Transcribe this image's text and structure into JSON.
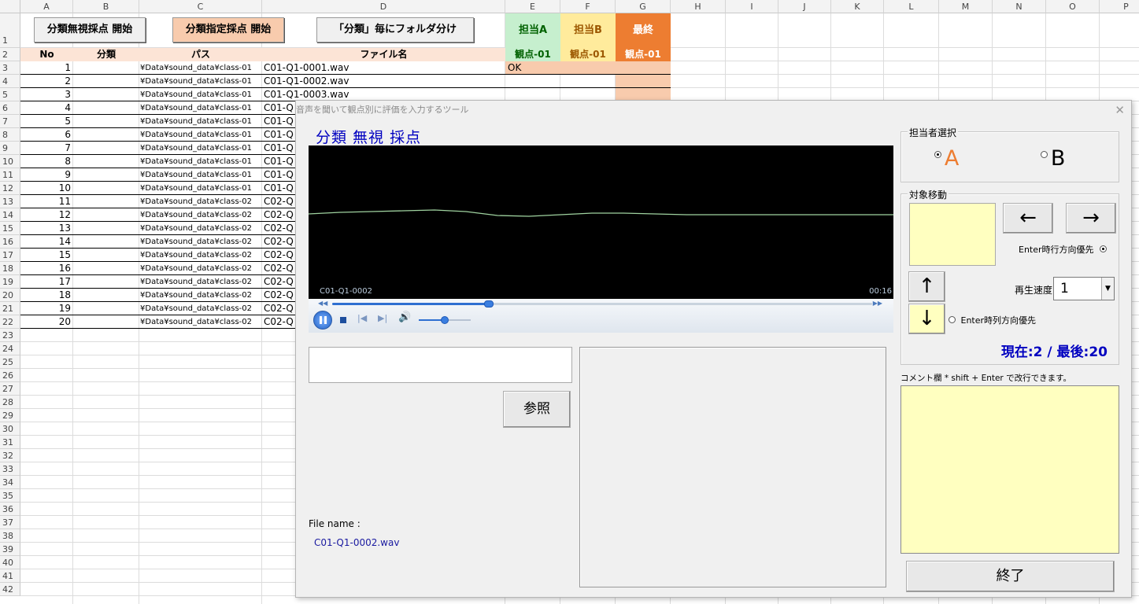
{
  "sheet": {
    "columns": [
      "A",
      "B",
      "C",
      "D",
      "E",
      "F",
      "G",
      "H",
      "I",
      "J",
      "K",
      "L",
      "M",
      "N",
      "O",
      "P"
    ],
    "rows": [
      "1",
      "2",
      "3",
      "4",
      "5",
      "6",
      "7",
      "8",
      "9",
      "10",
      "11",
      "12",
      "13",
      "14",
      "15",
      "16",
      "17",
      "18",
      "19",
      "20",
      "21",
      "22",
      "23",
      "24",
      "25",
      "26",
      "27",
      "28",
      "29",
      "30",
      "31",
      "32",
      "33",
      "34",
      "35",
      "36",
      "37",
      "38",
      "39",
      "40",
      "41",
      "42"
    ],
    "buttons": {
      "ignore_start": "分類無視採点 開始",
      "specified_start": "分類指定採点 開始",
      "folder_split": "「分類」毎にフォルダ分け"
    },
    "header_top": {
      "rater_a": "担当A",
      "rater_b": "担当B",
      "final": "最終"
    },
    "header": {
      "no": "No",
      "category": "分類",
      "path": "パス",
      "filename": "ファイル名",
      "view_a": "観点-01",
      "view_b": "観点-01",
      "view_final": "観点-01"
    },
    "data_rows": [
      {
        "no": "1",
        "path": "¥Data¥sound_data¥class-01",
        "file": "C01-Q1-0001.wav",
        "a": "OK"
      },
      {
        "no": "2",
        "path": "¥Data¥sound_data¥class-01",
        "file": "C01-Q1-0002.wav",
        "a": ""
      },
      {
        "no": "3",
        "path": "¥Data¥sound_data¥class-01",
        "file": "C01-Q1-0003.wav",
        "a": ""
      },
      {
        "no": "4",
        "path": "¥Data¥sound_data¥class-01",
        "file": "C01-Q",
        "a": ""
      },
      {
        "no": "5",
        "path": "¥Data¥sound_data¥class-01",
        "file": "C01-Q",
        "a": ""
      },
      {
        "no": "6",
        "path": "¥Data¥sound_data¥class-01",
        "file": "C01-Q",
        "a": ""
      },
      {
        "no": "7",
        "path": "¥Data¥sound_data¥class-01",
        "file": "C01-Q",
        "a": ""
      },
      {
        "no": "8",
        "path": "¥Data¥sound_data¥class-01",
        "file": "C01-Q",
        "a": ""
      },
      {
        "no": "9",
        "path": "¥Data¥sound_data¥class-01",
        "file": "C01-Q",
        "a": ""
      },
      {
        "no": "10",
        "path": "¥Data¥sound_data¥class-01",
        "file": "C01-Q",
        "a": ""
      },
      {
        "no": "11",
        "path": "¥Data¥sound_data¥class-02",
        "file": "C02-Q",
        "a": ""
      },
      {
        "no": "12",
        "path": "¥Data¥sound_data¥class-02",
        "file": "C02-Q",
        "a": ""
      },
      {
        "no": "13",
        "path": "¥Data¥sound_data¥class-02",
        "file": "C02-Q",
        "a": ""
      },
      {
        "no": "14",
        "path": "¥Data¥sound_data¥class-02",
        "file": "C02-Q",
        "a": ""
      },
      {
        "no": "15",
        "path": "¥Data¥sound_data¥class-02",
        "file": "C02-Q",
        "a": ""
      },
      {
        "no": "16",
        "path": "¥Data¥sound_data¥class-02",
        "file": "C02-Q",
        "a": ""
      },
      {
        "no": "17",
        "path": "¥Data¥sound_data¥class-02",
        "file": "C02-Q",
        "a": ""
      },
      {
        "no": "18",
        "path": "¥Data¥sound_data¥class-02",
        "file": "C02-Q",
        "a": ""
      },
      {
        "no": "19",
        "path": "¥Data¥sound_data¥class-02",
        "file": "C02-Q",
        "a": ""
      },
      {
        "no": "20",
        "path": "¥Data¥sound_data¥class-02",
        "file": "C02-Q",
        "a": ""
      }
    ],
    "colors": {
      "rater_a": "#c6efce",
      "rater_b": "#ffeb9c",
      "final": "#ed7d31",
      "final_cells": "#f8cbad",
      "header_row": "#fce4d6",
      "button_peach": "#f8cbad"
    }
  },
  "dialog": {
    "title": "音声を聞いて観点別に評価を入力するツール",
    "close": "✕",
    "mode_title": "分類 無視 採点",
    "player": {
      "track": "C01-Q1-0002",
      "time": "00:16",
      "progress": 0.29,
      "volume": 0.5,
      "pause_icon": "pause-icon",
      "stop_icon": "stop-icon",
      "prev_icon": "previous-icon",
      "next_icon": "next-icon",
      "volume_icon": "volume-icon"
    },
    "path_input": "",
    "browse_button": "参照",
    "file_name_label": "File name :",
    "file_name_value": "C01-Q1-0002.wav",
    "rater_group": {
      "caption": "担当者選択",
      "option_a": "A",
      "option_b": "B",
      "selected": "A"
    },
    "move_group": {
      "caption": "対象移動",
      "left_arrow": "←",
      "right_arrow": "→",
      "up_arrow": "↑",
      "down_arrow": "↓",
      "enter_row_label": "Enter時行方向優先",
      "enter_col_label": "Enter時列方向優先",
      "enter_mode": "row",
      "speed_label": "再生速度 :",
      "speed_value": "1",
      "position": "現在:2 / 最後:20"
    },
    "comment_label": "コメント欄 * shift + Enter で改行できます。",
    "comment_value": "",
    "exit_button": "終了"
  }
}
